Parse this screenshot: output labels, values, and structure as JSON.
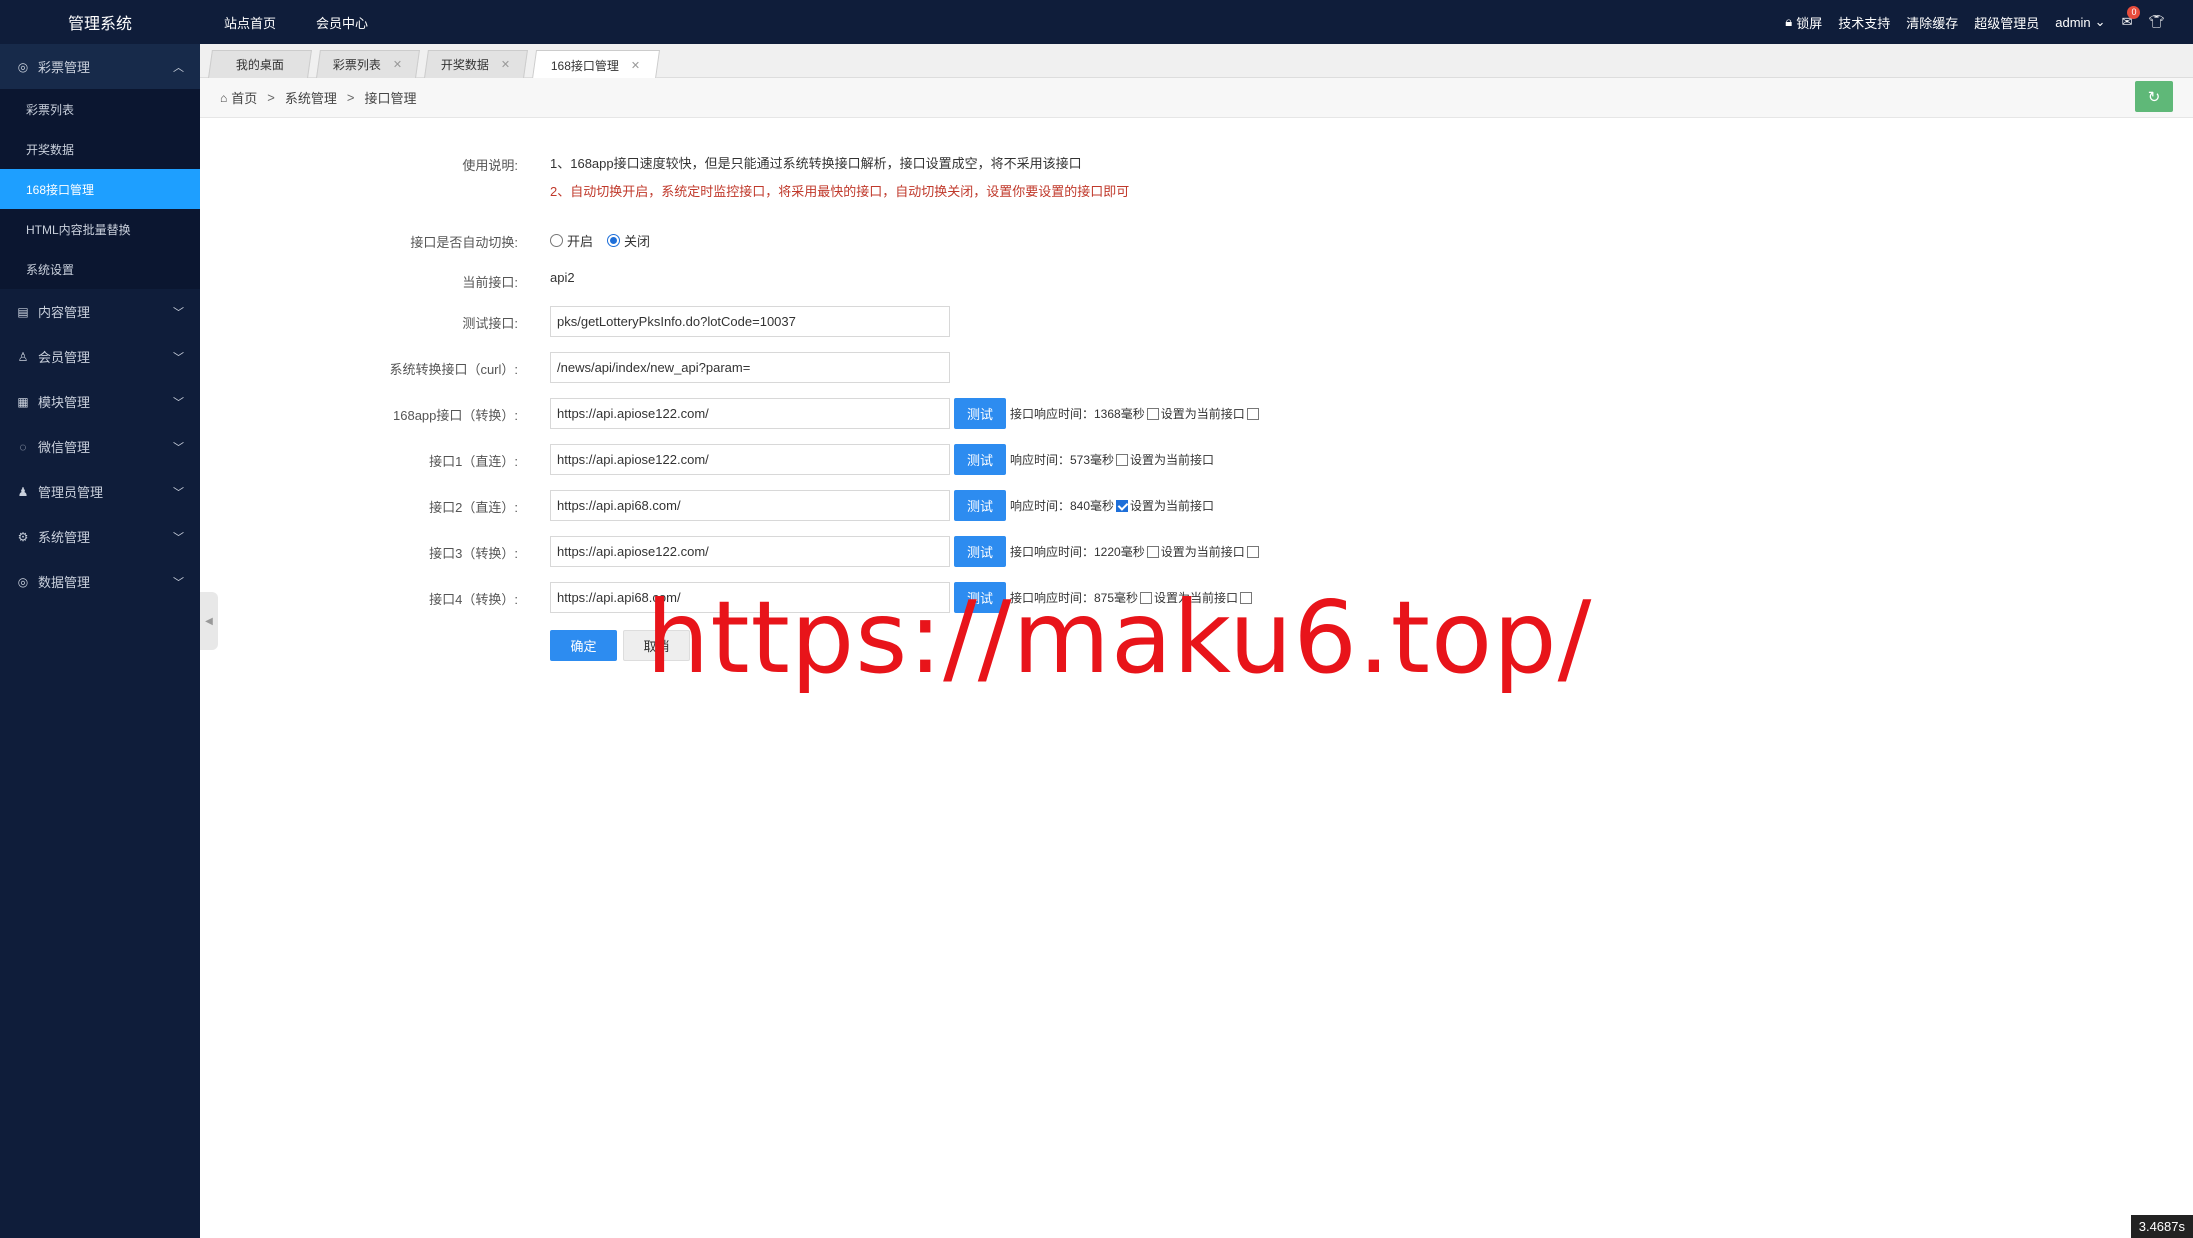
{
  "header": {
    "logo": "管理系统",
    "nav": [
      "站点首页",
      "会员中心"
    ],
    "lock": "锁屏",
    "support": "技术支持",
    "clear_cache": "清除缓存",
    "role": "超级管理员",
    "user": "admin",
    "mail_badge": "0"
  },
  "sidebar": {
    "groups": [
      {
        "label": "彩票管理",
        "icon": "database-icon"
      },
      {
        "label": "内容管理",
        "icon": "document-icon"
      },
      {
        "label": "会员管理",
        "icon": "user-icon"
      },
      {
        "label": "模块管理",
        "icon": "grid-icon"
      },
      {
        "label": "微信管理",
        "icon": "wechat-icon"
      },
      {
        "label": "管理员管理",
        "icon": "admin-icon"
      },
      {
        "label": "系统管理",
        "icon": "gear-icon"
      },
      {
        "label": "数据管理",
        "icon": "database-icon"
      }
    ],
    "subitems": [
      "彩票列表",
      "开奖数据",
      "168接口管理",
      "HTML内容批量替换",
      "系统设置"
    ],
    "active_subitem": "168接口管理"
  },
  "tabs": [
    "我的桌面",
    "彩票列表",
    "开奖数据",
    "168接口管理"
  ],
  "breadcrumb": [
    "首页",
    "系统管理",
    "接口管理"
  ],
  "form": {
    "usage_label": "使用说明:",
    "usage_line1": "1、168app接口速度较快，但是只能通过系统转换接口解析，接口设置成空，将不采用该接口",
    "usage_line2": "2、自动切换开启，系统定时监控接口，将采用最快的接口，自动切换关闭，设置你要设置的接口即可",
    "auto_switch_label": "接口是否自动切换:",
    "auto_on": "开启",
    "auto_off": "关闭",
    "auto_switch_value": "关闭",
    "current_api_label": "当前接口:",
    "current_api": "api2",
    "test_api_label": "测试接口:",
    "test_api": "pks/getLotteryPksInfo.do?lotCode=10037",
    "convert_api_label": "系统转换接口（curl）:",
    "convert_api": "/news/api/index/new_api?param=",
    "test_btn": "测试",
    "set_current": "设置为当前接口",
    "apis": [
      {
        "label": "168app接口（转换）:",
        "url": "https://api.apiose122.com/",
        "resp": "接口响应时间：1368毫秒",
        "checked": false,
        "trail": true
      },
      {
        "label": "接口1（直连）:",
        "url": "https://api.apiose122.com/",
        "resp": "响应时间：573毫秒",
        "checked": false,
        "trail": false
      },
      {
        "label": "接口2（直连）:",
        "url": "https://api.api68.com/",
        "resp": "响应时间：840毫秒",
        "checked": true,
        "trail": false
      },
      {
        "label": "接口3（转换）:",
        "url": "https://api.apiose122.com/",
        "resp": "接口响应时间：1220毫秒",
        "checked": false,
        "trail": true
      },
      {
        "label": "接口4（转换）:",
        "url": "https://api.api68.com/",
        "resp": "接口响应时间：875毫秒",
        "checked": false,
        "trail": true
      }
    ],
    "ok_btn": "确定",
    "cancel_btn": "取消"
  },
  "watermark": "https://maku6.top/",
  "timer": "3.4687s"
}
